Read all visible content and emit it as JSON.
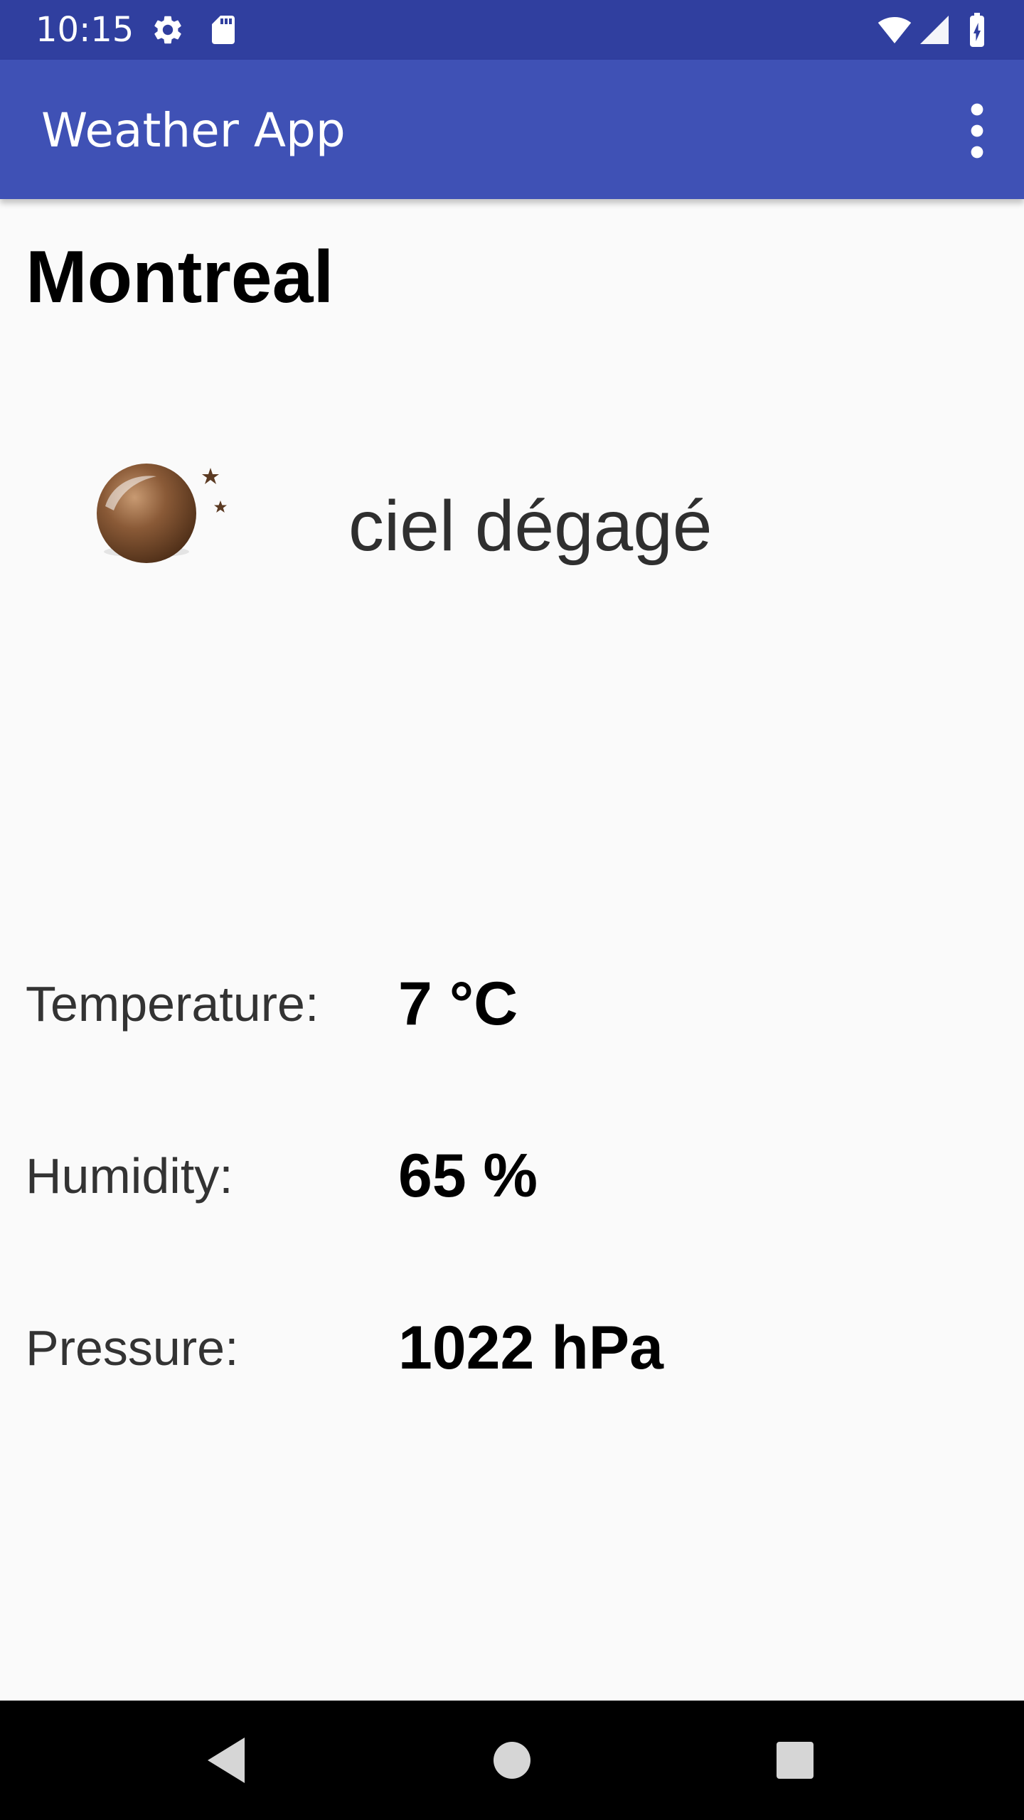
{
  "status_bar": {
    "time": "10:15",
    "icons": [
      "gear-icon",
      "sd-card-icon",
      "wifi-icon",
      "cell-signal-icon",
      "battery-charging-icon"
    ]
  },
  "app_bar": {
    "title": "Weather App",
    "menu_icon": "overflow-menu-icon"
  },
  "weather": {
    "city": "Montreal",
    "icon": "clear-night-icon",
    "description": "ciel dégagé",
    "stats": [
      {
        "label": "Temperature:",
        "value": "7 °C"
      },
      {
        "label": "Humidity:",
        "value": "65 %"
      },
      {
        "label": "Pressure:",
        "value": "1022 hPa"
      }
    ]
  },
  "nav_bar": {
    "buttons": [
      "back-icon",
      "home-icon",
      "recents-icon"
    ]
  },
  "colors": {
    "status_bar": "#303f9f",
    "app_bar": "#3f51b5",
    "background": "#fafafa"
  }
}
